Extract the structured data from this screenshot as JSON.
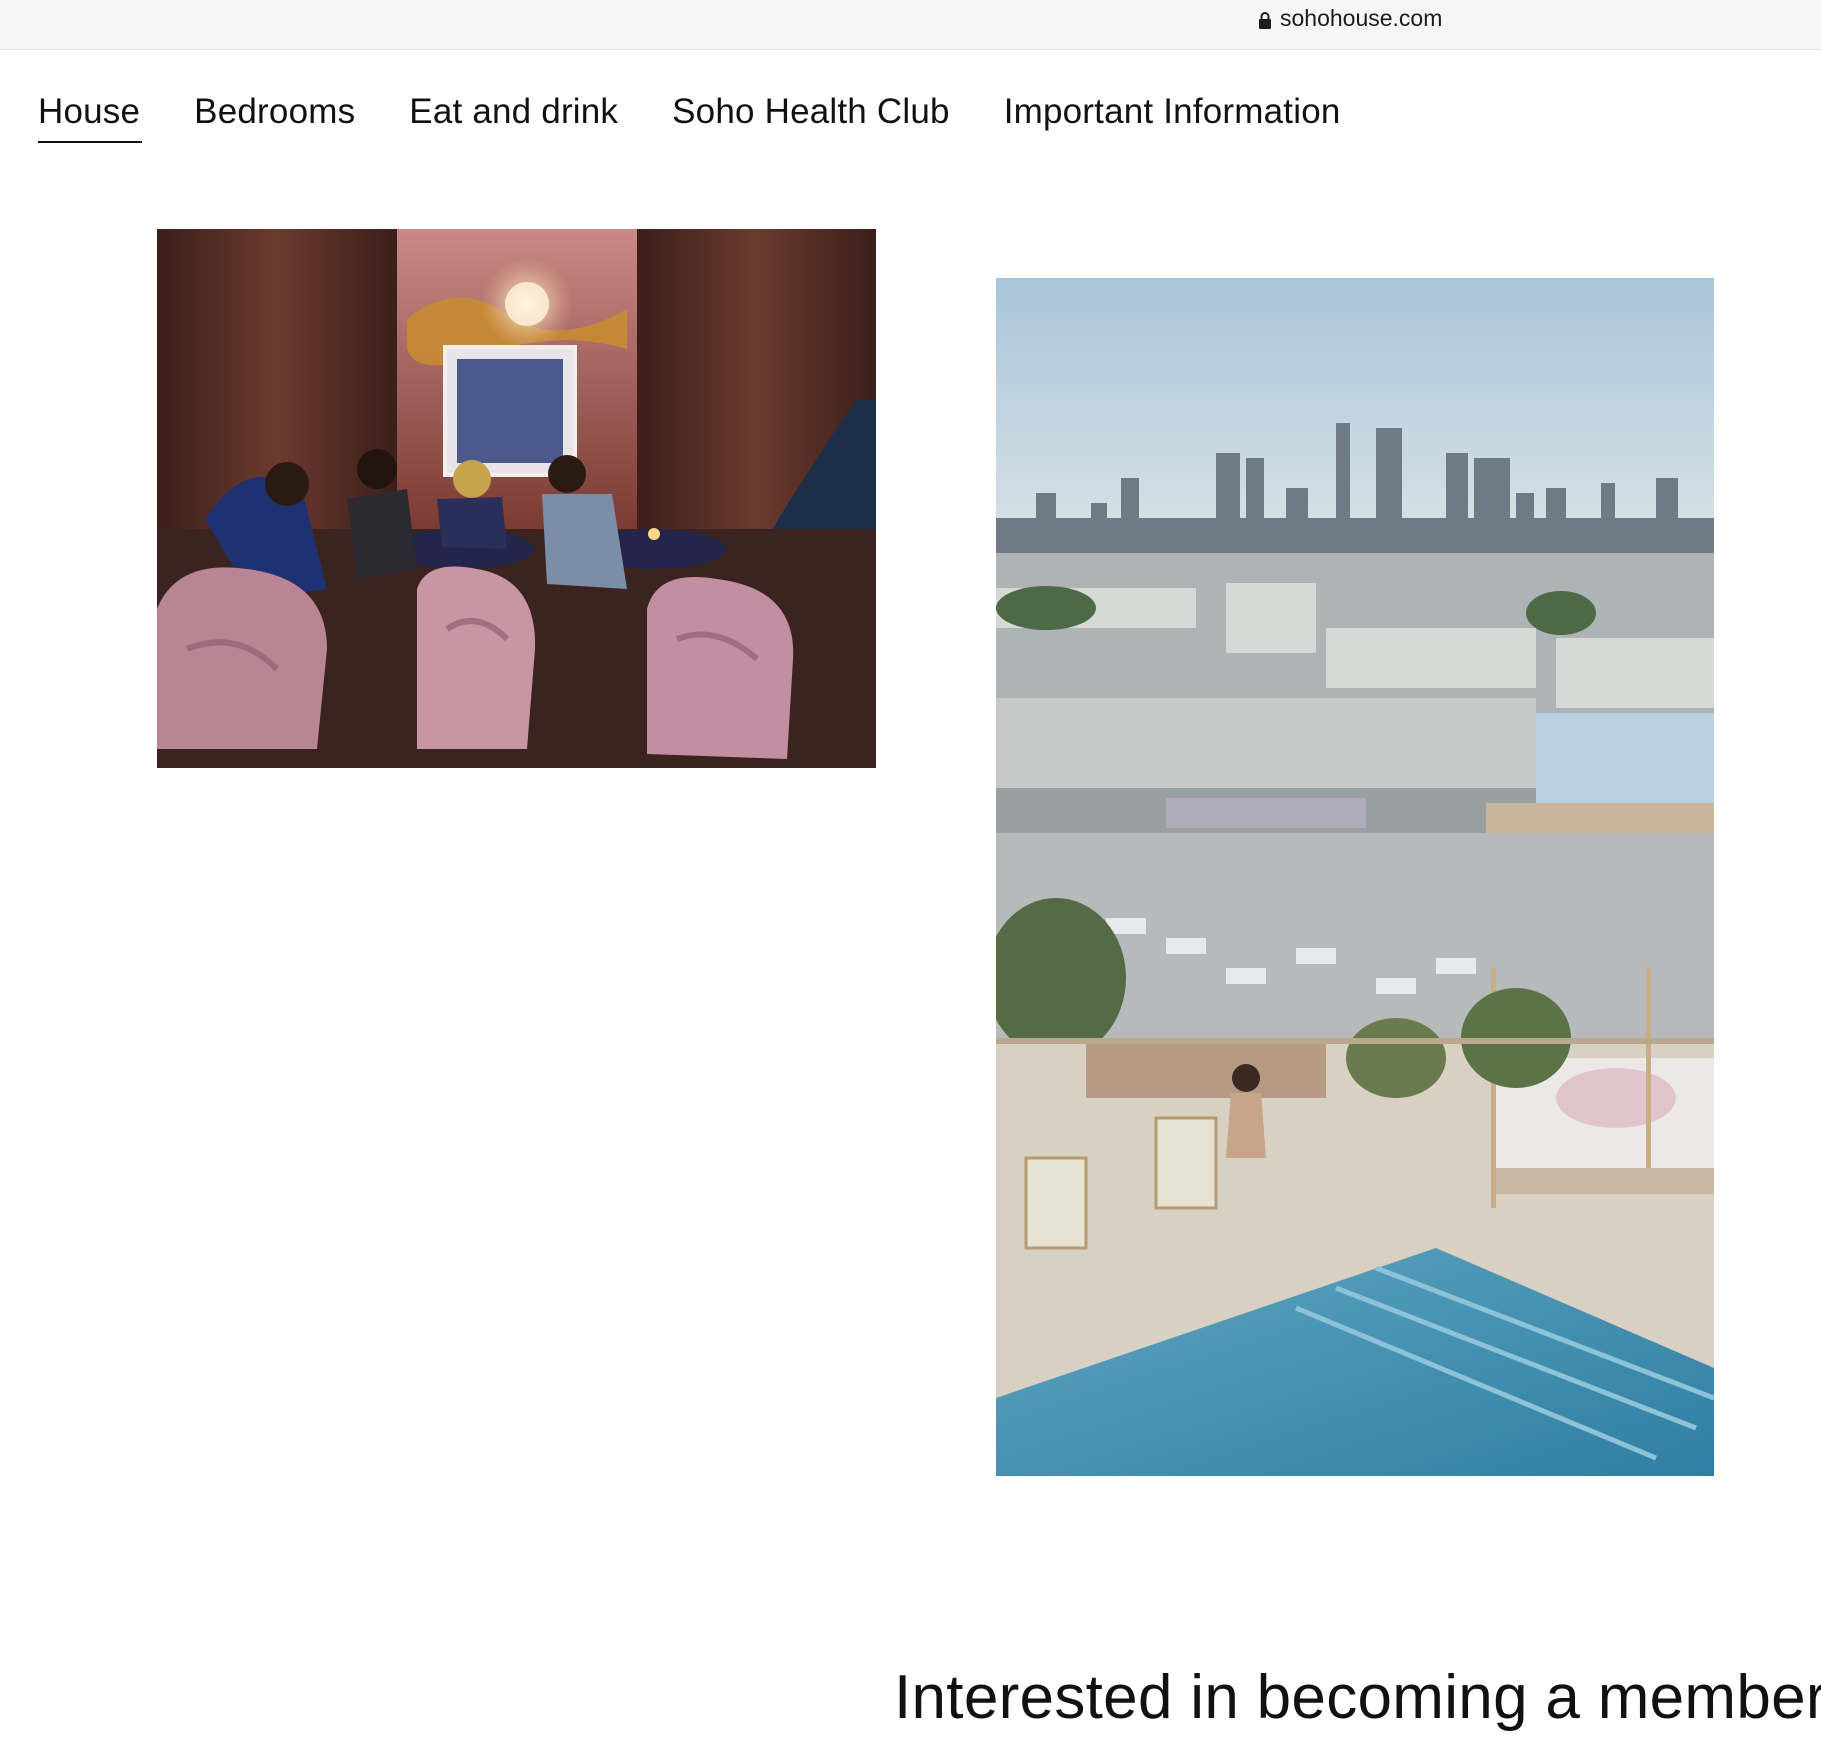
{
  "browser": {
    "url": "sohohouse.com",
    "lock_icon": "lock-icon"
  },
  "nav": {
    "items": [
      {
        "label": "House",
        "active": true
      },
      {
        "label": "Bedrooms",
        "active": false
      },
      {
        "label": "Eat and drink",
        "active": false
      },
      {
        "label": "Soho Health Club",
        "active": false
      },
      {
        "label": "Important Information",
        "active": false
      }
    ]
  },
  "main": {
    "cta_heading": "Interested in becoming a member?"
  }
}
